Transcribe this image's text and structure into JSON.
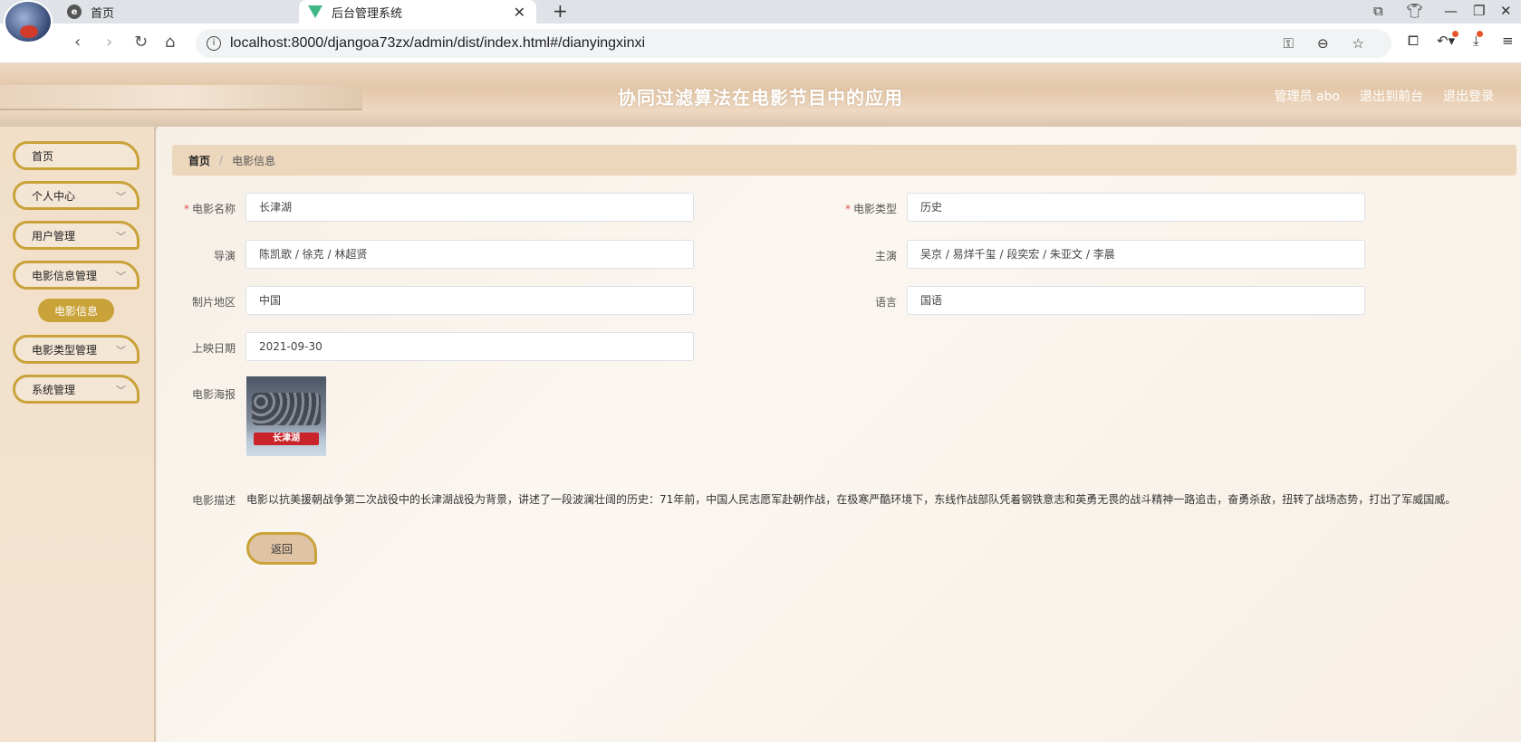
{
  "browser": {
    "tabs": [
      {
        "label": "首页",
        "icon": "edge-logo-icon"
      },
      {
        "label": "后台管理系统",
        "icon": "vue-logo-icon"
      }
    ],
    "url": "localhost:8000/djangoa73zx/admin/dist/index.html#/dianyingxinxi"
  },
  "header": {
    "title": "协同过滤算法在电影节目中的应用",
    "user_label": "管理员 abo",
    "front_link": "退出到前台",
    "logout_link": "退出登录"
  },
  "sidebar": {
    "items": [
      {
        "label": "首页"
      },
      {
        "label": "个人中心"
      },
      {
        "label": "用户管理"
      },
      {
        "label": "电影信息管理"
      },
      {
        "label": "电影类型管理"
      },
      {
        "label": "系统管理"
      }
    ],
    "active_sub": "电影信息"
  },
  "breadcrumb": {
    "home": "首页",
    "separator": "/",
    "current": "电影信息"
  },
  "form": {
    "name_label": "电影名称",
    "name_value": "长津湖",
    "type_label": "电影类型",
    "type_value": "历史",
    "director_label": "导演",
    "director_value": "陈凯歌 / 徐克 / 林超贤",
    "cast_label": "主演",
    "cast_value": "吴京 / 易烊千玺 / 段奕宏 / 朱亚文 / 李晨",
    "region_label": "制片地区",
    "region_value": "中国",
    "language_label": "语言",
    "language_value": "国语",
    "date_label": "上映日期",
    "date_value": "2021-09-30",
    "poster_label": "电影海报",
    "poster_title": "长津湖",
    "desc_label": "电影描述",
    "desc_value": "电影以抗美援朝战争第二次战役中的长津湖战役为背景，讲述了一段波澜壮阔的历史：71年前，中国人民志愿军赴朝作战，在极寒严酷环境下，东线作战部队凭着钢铁意志和英勇无畏的战斗精神一路追击，奋勇杀敌，扭转了战场态势，打出了军威国威。",
    "back_button": "返回"
  },
  "colors": {
    "accent": "#c9a23a",
    "required": "#e05050"
  }
}
